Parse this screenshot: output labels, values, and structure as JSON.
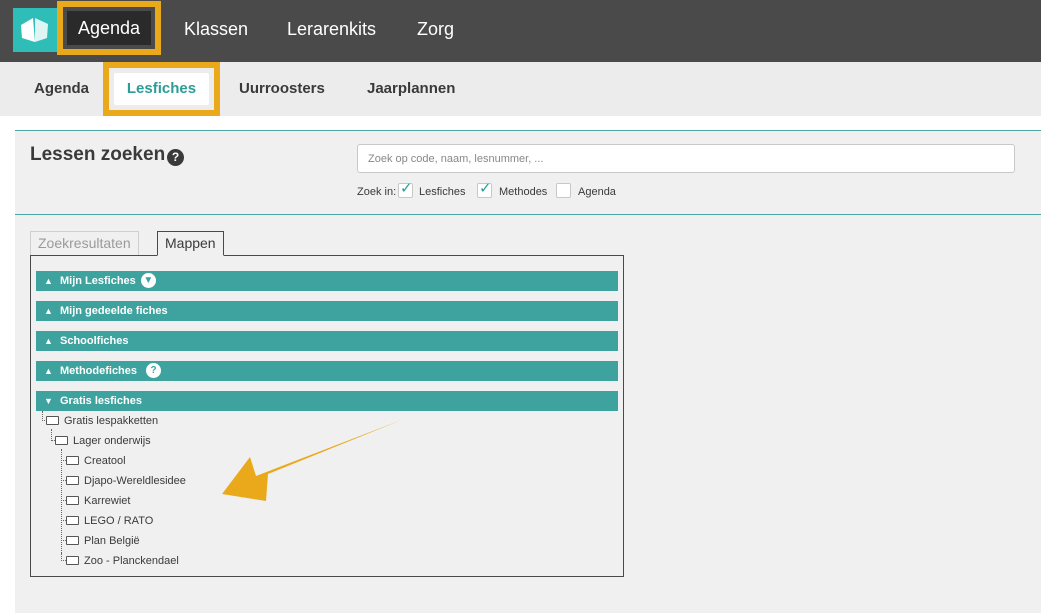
{
  "topnav": {
    "items": [
      "Agenda",
      "Klassen",
      "Lerarenkits",
      "Zorg"
    ]
  },
  "subnav": {
    "items": [
      "Agenda",
      "Lesfiches",
      "Uurroosters",
      "Jaarplannen"
    ]
  },
  "search": {
    "title": "Lessen zoeken",
    "help": "?",
    "placeholder": "Zoek op code, naam, lesnummer, ...",
    "zoek_in_label": "Zoek in:",
    "options": [
      {
        "label": "Lesfiches",
        "checked": true
      },
      {
        "label": "Methodes",
        "checked": true
      },
      {
        "label": "Agenda",
        "checked": false
      }
    ]
  },
  "tabs": [
    "Zoekresultaten",
    "Mappen"
  ],
  "accordions": [
    {
      "label": "Mijn Lesfiches",
      "expanded": false
    },
    {
      "label": "Mijn gedeelde fiches",
      "expanded": false
    },
    {
      "label": "Schoolfiches",
      "expanded": false
    },
    {
      "label": "Methodefiches",
      "expanded": false
    },
    {
      "label": "Gratis lesfiches",
      "expanded": true
    }
  ],
  "tree": {
    "root": "Gratis lespakketten",
    "sub": "Lager onderwijs",
    "folders": [
      "Creatool",
      "Djapo-Wereldlesidee",
      "Karrewiet",
      "LEGO / RATO",
      "Plan België",
      "Zoo - Planckendael"
    ]
  },
  "colors": {
    "accent": "#3ea39f",
    "highlight": "#e9a91b",
    "topbar": "#4a4a4a"
  }
}
